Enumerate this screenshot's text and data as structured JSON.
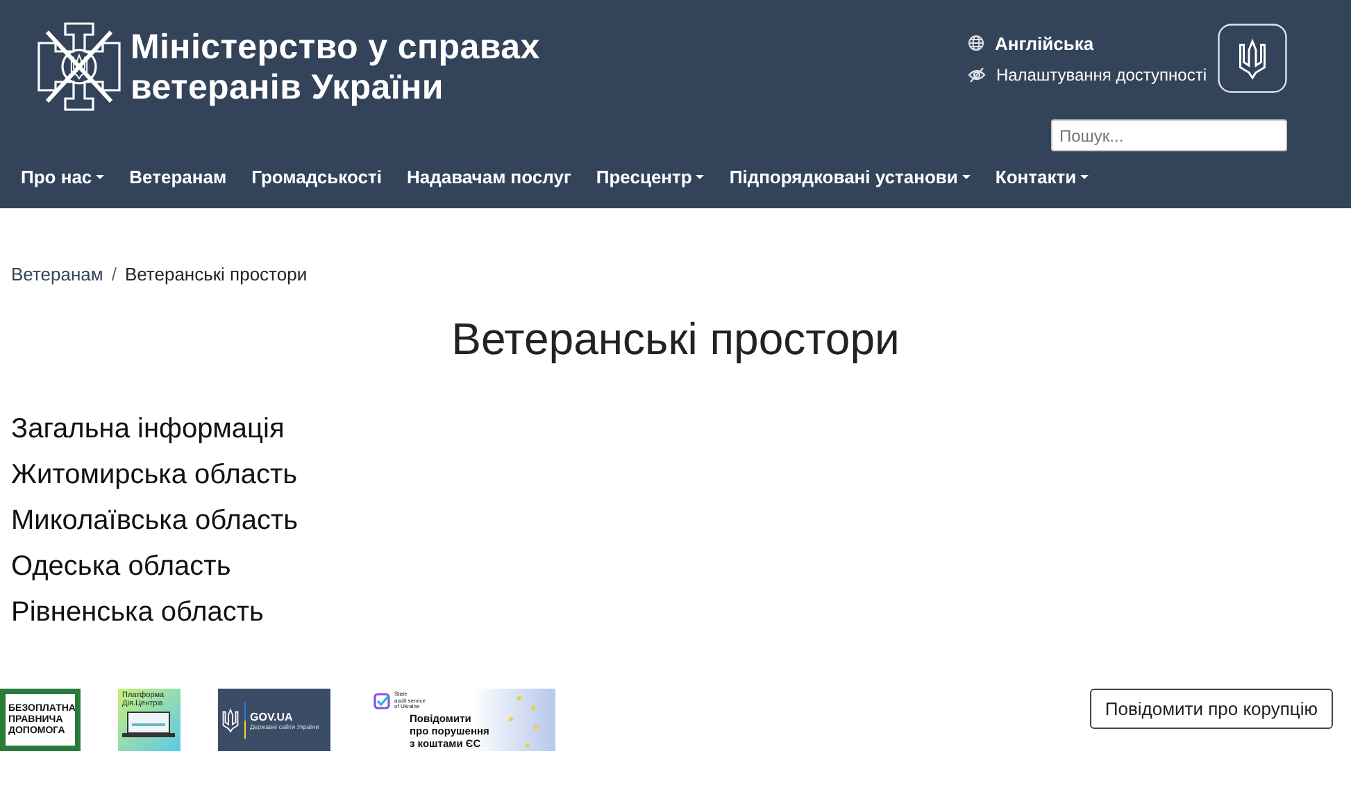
{
  "header": {
    "title_lines": [
      "Міністерство у справах",
      "ветеранів України"
    ],
    "language_link": "Англійська",
    "accessibility_link": "Налаштування доступності",
    "search": {
      "placeholder": "Пошук..."
    }
  },
  "nav": [
    {
      "label": "Про нас",
      "dropdown": true
    },
    {
      "label": "Ветеранам",
      "dropdown": false
    },
    {
      "label": "Громадськості",
      "dropdown": false
    },
    {
      "label": "Надавачам послуг",
      "dropdown": false
    },
    {
      "label": "Пресцентр",
      "dropdown": true
    },
    {
      "label": "Підпорядковані установи",
      "dropdown": true
    },
    {
      "label": "Контакти",
      "dropdown": true
    }
  ],
  "breadcrumb": {
    "separator": "/",
    "items": [
      "Ветеранам",
      "Ветеранські простори"
    ]
  },
  "page_title": "Ветеранські простори",
  "links": [
    "Загальна інформація",
    "Житомирська область",
    "Миколаївська область",
    "Одеська область",
    "Рівненська область"
  ],
  "footer": {
    "banners": [
      {
        "kind": "legal-aid",
        "lines": [
          "БЕЗОПЛАТНА",
          "ПРАВНИЧА",
          "ДОПОМОГА"
        ]
      },
      {
        "kind": "platform",
        "lines": [
          "Платформа",
          "Дія.Центрів"
        ]
      },
      {
        "kind": "govua",
        "lines": [
          "GOV.UA",
          "Державні сайти України"
        ]
      },
      {
        "kind": "audit",
        "lines": [
          "State",
          "audit service",
          "of Ukraine",
          "Повідомити",
          "про порушення",
          "з коштами ЄС"
        ]
      }
    ],
    "report_button": "Повідомити про корупцію"
  }
}
